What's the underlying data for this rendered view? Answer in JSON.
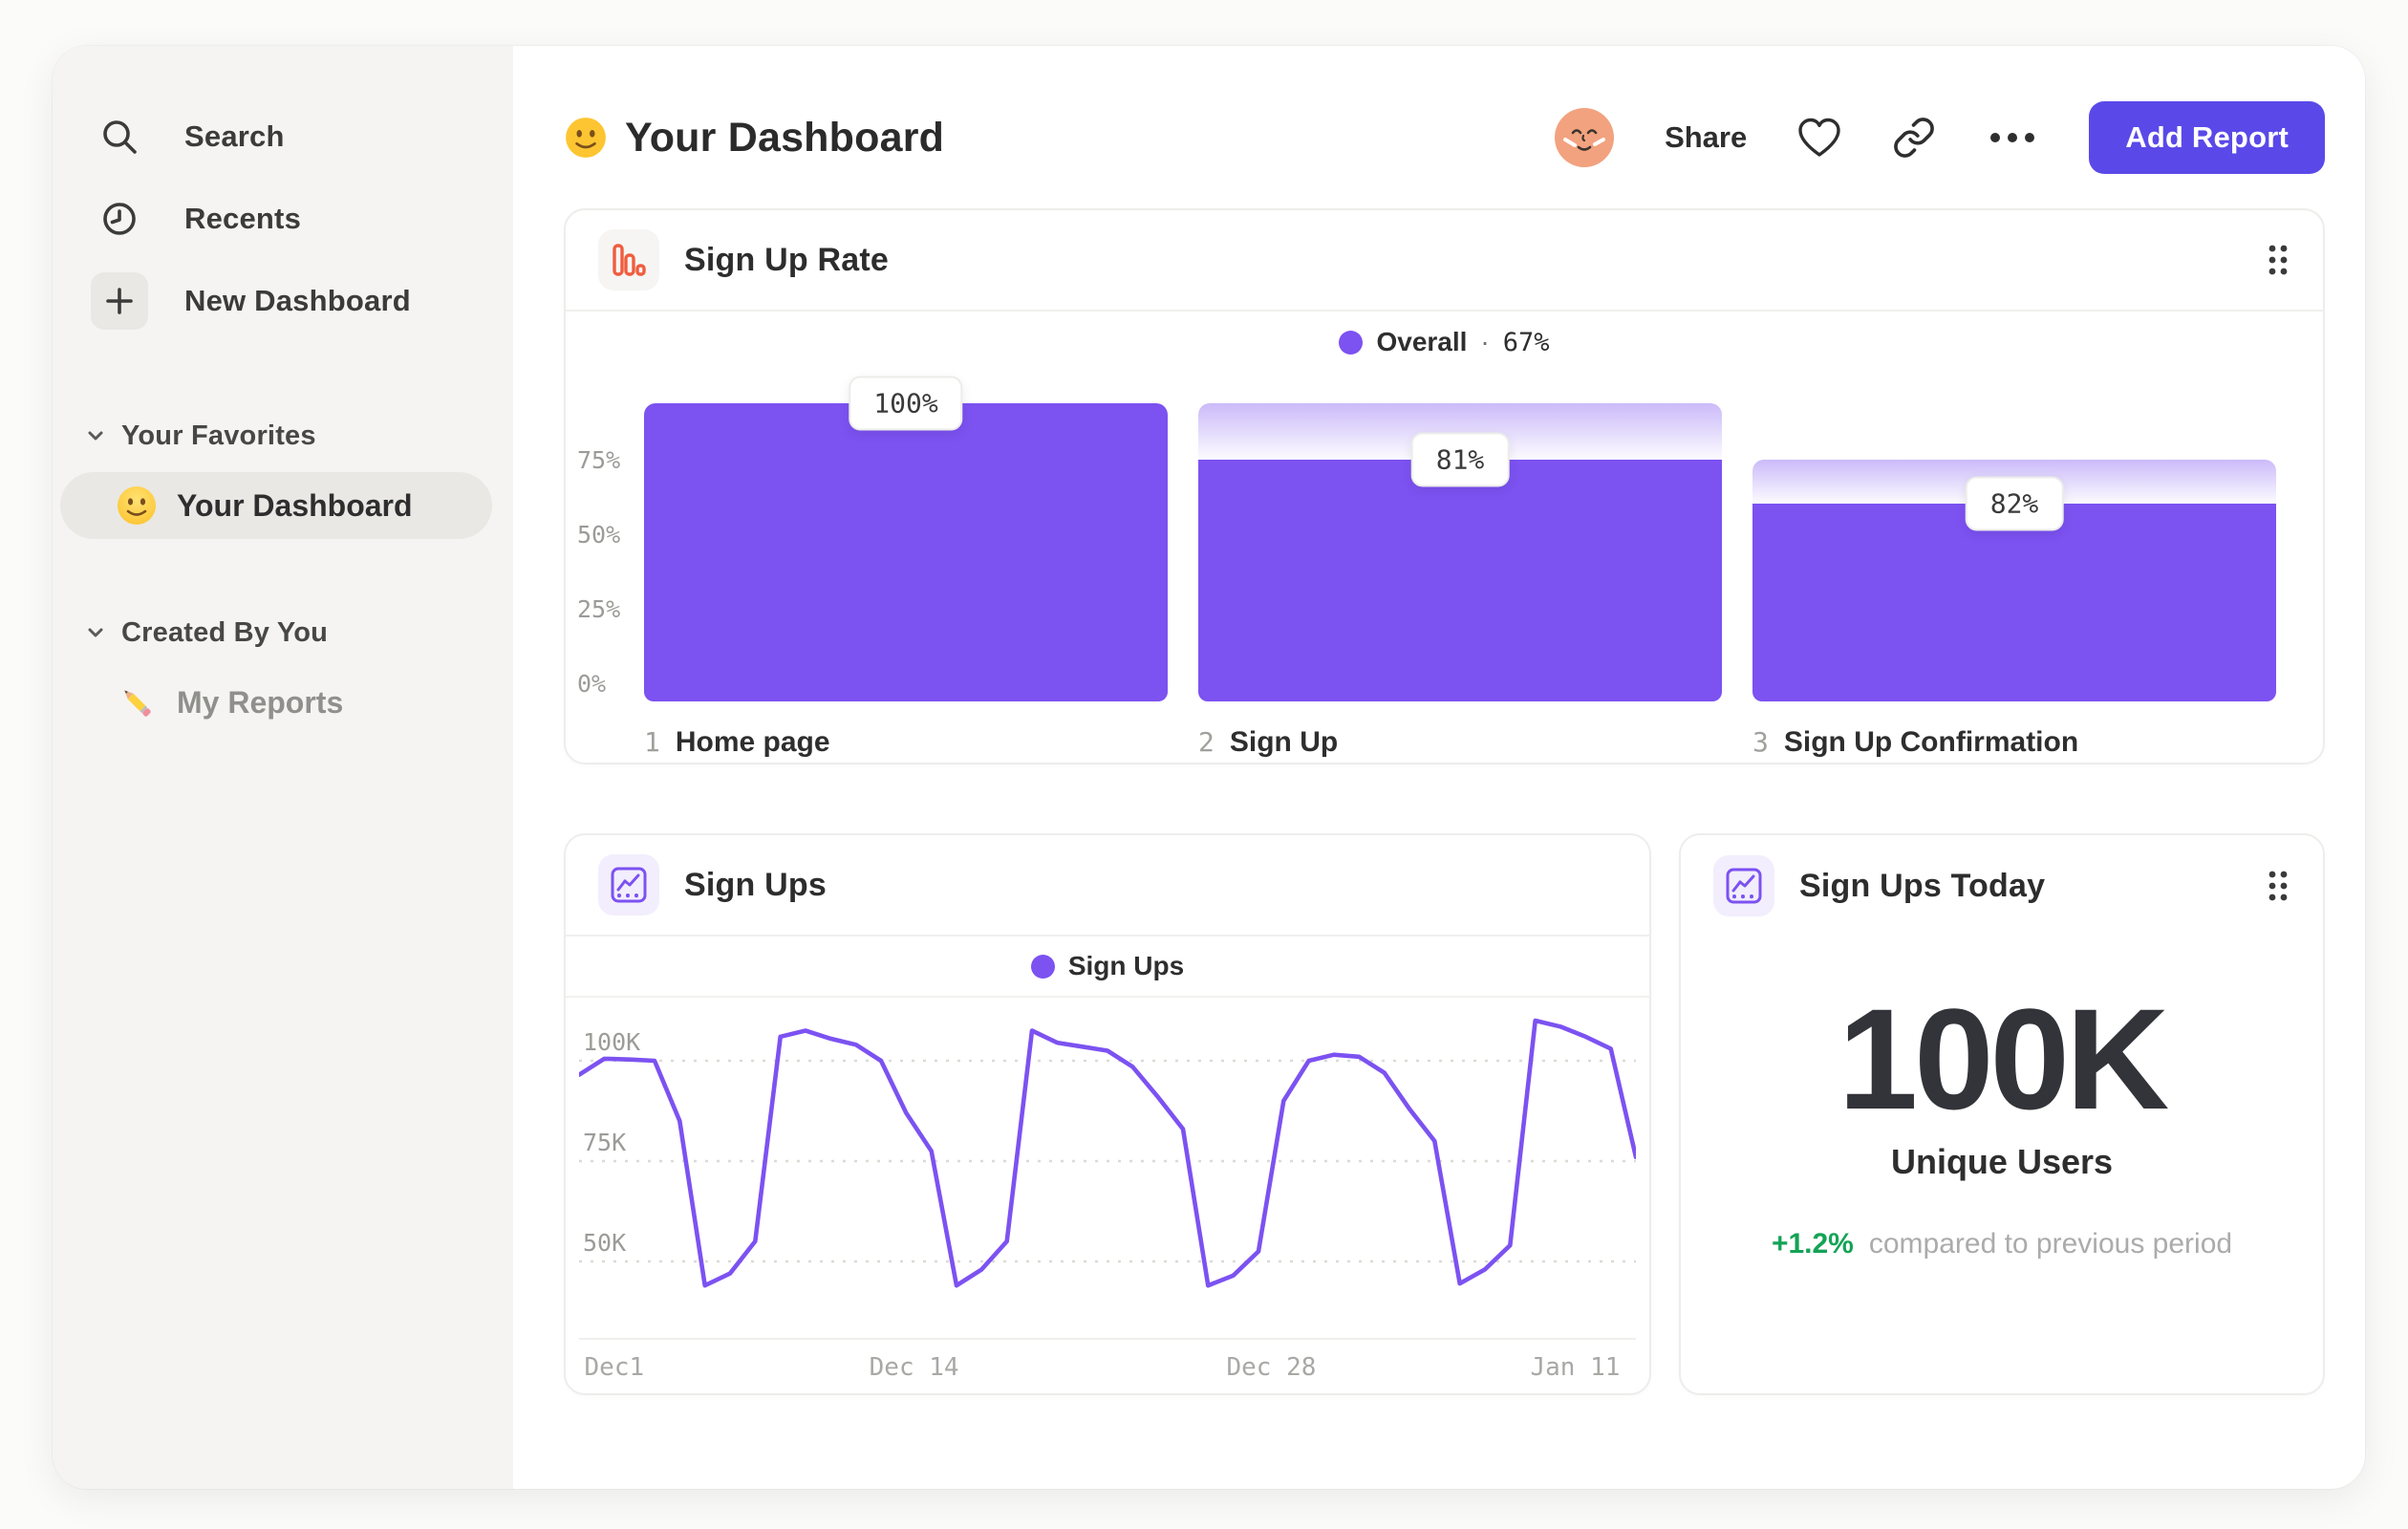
{
  "theme": {
    "accent": "#7C52F1",
    "button": "#5A49E8",
    "orange": "#F05C3E",
    "green": "#14A356",
    "ink": "#303030",
    "pagebg": "#FBFBFA",
    "sidebg": "#F5F4F2"
  },
  "sidebar": {
    "items": [
      {
        "icon": "search-icon",
        "label": "Search"
      },
      {
        "icon": "clock-icon",
        "label": "Recents"
      },
      {
        "icon": "plus-icon",
        "label": "New Dashboard"
      }
    ],
    "sections": [
      {
        "title": "Your Favorites",
        "item": {
          "emoji": "smiley",
          "label": "Your Dashboard",
          "selected": true
        }
      },
      {
        "title": "Created By You",
        "item": {
          "emoji": "pencil",
          "label": "My Reports",
          "selected": false
        }
      }
    ]
  },
  "header": {
    "emoji": "smiley",
    "title": "Your Dashboard",
    "share_label": "Share",
    "add_report_label": "Add Report"
  },
  "charts": {
    "funnel": {
      "type": "bar",
      "title": "Sign Up Rate",
      "legend": {
        "label": "Overall",
        "sep": "·",
        "value": "67%"
      },
      "yticks": [
        {
          "label": "75%",
          "v": 75
        },
        {
          "label": "50%",
          "v": 50
        },
        {
          "label": "25%",
          "v": 25
        },
        {
          "label": "0%",
          "v": 0
        }
      ],
      "steps": [
        {
          "index": "1",
          "label": "Home page",
          "rate": 1.0,
          "display": "100%"
        },
        {
          "index": "2",
          "label": "Sign Up",
          "rate": 0.81,
          "display": "81%"
        },
        {
          "index": "3",
          "label": "Sign Up Confirmation",
          "rate": 0.82,
          "display": "82%"
        }
      ]
    },
    "line": {
      "type": "line",
      "title": "Sign Ups",
      "legend": {
        "label": "Sign Ups"
      },
      "unit": "K",
      "yticks": [
        {
          "label": "100K",
          "v": 100
        },
        {
          "label": "75K",
          "v": 75
        },
        {
          "label": "50K",
          "v": 50
        }
      ],
      "xticks": [
        {
          "label": "Dec1",
          "f": 0.005,
          "anchor": "start"
        },
        {
          "label": "Dec 14",
          "f": 0.317,
          "anchor": "middle"
        },
        {
          "label": "Dec 28",
          "f": 0.655,
          "anchor": "middle"
        },
        {
          "label": "Jan 11",
          "f": 0.985,
          "anchor": "end"
        }
      ],
      "values": [
        96.5,
        100.5,
        100.3,
        100,
        85,
        44,
        47,
        55,
        106,
        107.5,
        105.5,
        104,
        100,
        87,
        77.5,
        44,
        48,
        55,
        107.5,
        104.5,
        103.5,
        102.5,
        98.5,
        91,
        83,
        44,
        46.5,
        52.5,
        90,
        100,
        101.5,
        101,
        97,
        88,
        80,
        44.5,
        48,
        54,
        110,
        108.5,
        106,
        103,
        76
      ]
    },
    "today": {
      "title": "Sign Ups Today",
      "metric": "100K",
      "caption": "Unique Users",
      "delta": "+1.2%",
      "delta_caption": "compared to previous period"
    }
  }
}
